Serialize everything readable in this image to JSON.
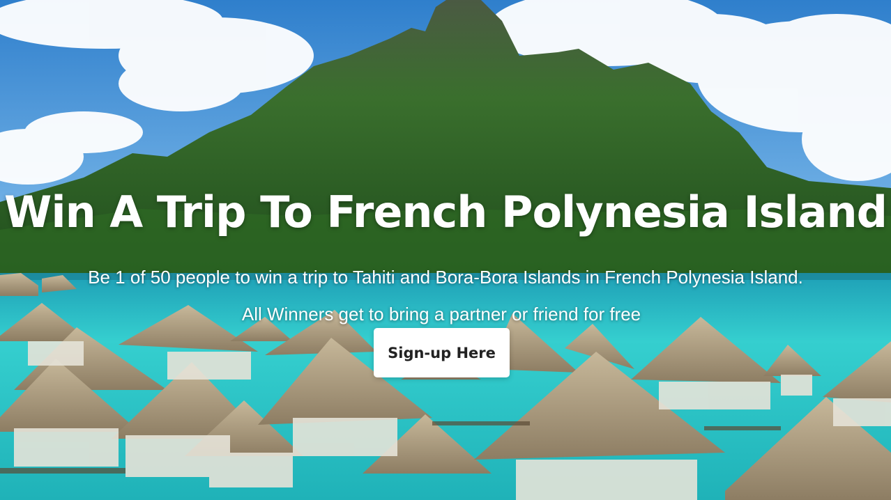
{
  "hero": {
    "title": "Win A Trip To French Polynesia Island",
    "subtitle": "Be 1 of 50 people to win a trip to Tahiti and Bora-Bora Islands in French Polynesia Island.",
    "subtitle2": "All Winners get to bring a partner or friend for free",
    "cta_label": "Sign-up Here"
  },
  "colors": {
    "sky": "#4a94d6",
    "lagoon": "#2ec5c6",
    "mountain": "#2f6b2a",
    "thatch": "#a8977a",
    "button_bg": "#ffffff",
    "button_text": "#222222"
  }
}
